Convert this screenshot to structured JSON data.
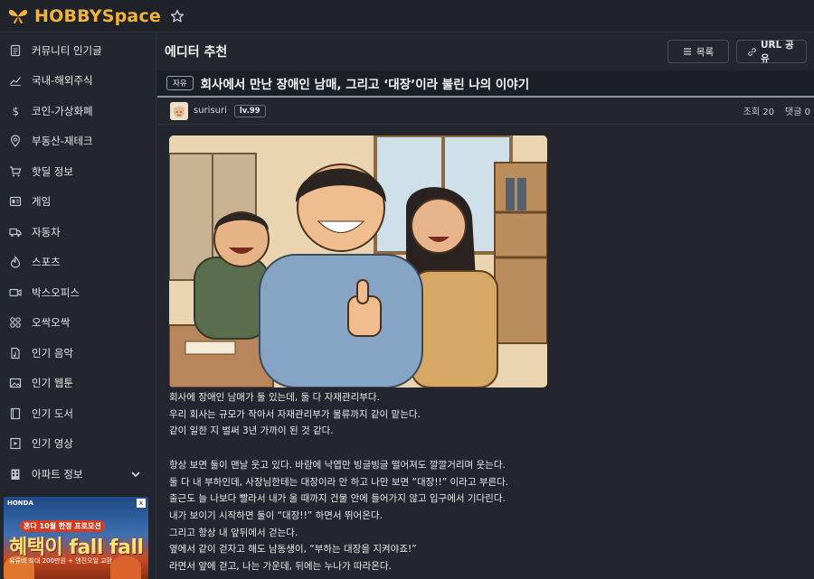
{
  "header": {
    "logo_text": "HOBBYSpace",
    "accent_color": "#f2b33d"
  },
  "sidebar": {
    "items": [
      {
        "label": "커뮤니티 인기글",
        "icon": "document-icon"
      },
      {
        "label": "국내-해외주식",
        "icon": "chart-line-icon"
      },
      {
        "label": "코인-가상화폐",
        "icon": "dollar-icon"
      },
      {
        "label": "부동산-재테크",
        "icon": "location-pin-icon"
      },
      {
        "label": "핫딜 정보",
        "icon": "cart-icon"
      },
      {
        "label": "게임",
        "icon": "gamepad-icon"
      },
      {
        "label": "자동차",
        "icon": "truck-icon"
      },
      {
        "label": "스포츠",
        "icon": "flame-icon"
      },
      {
        "label": "박스오피스",
        "icon": "video-camera-icon"
      },
      {
        "label": "오싹오싹",
        "icon": "grid-icon"
      },
      {
        "label": "인기 음악",
        "icon": "music-file-icon"
      },
      {
        "label": "인기 웹툰",
        "icon": "image-icon"
      },
      {
        "label": "인기 도서",
        "icon": "book-icon"
      },
      {
        "label": "인기 영상",
        "icon": "play-file-icon"
      },
      {
        "label": "아파트 정보",
        "icon": "building-icon"
      }
    ],
    "ad": {
      "brand": "HONDA",
      "close": "x",
      "sub": "혼다 10월 한정 프로모션",
      "title": "혜택이 fall fall",
      "foot": "유류비 최대 200만원 + 엔진오일 교환"
    }
  },
  "main": {
    "page_title": "에디터 추천",
    "list_button": "목록",
    "share_button": "URL 공유",
    "post": {
      "tag": "자유",
      "title": "회사에서 만난 장애인 남매, 그리고 ‘대장’이라 불린 나의 이야기",
      "username": "surisuri",
      "level": "lv.99",
      "views": "조회 20",
      "comments": "댓글 0",
      "body": [
        "회사에 장애인 남매가 둘 있는데, 둘 다 자재관리부다.",
        "우리 회사는 규모가 작아서 자재관리부가 물류까지 같이 맡는다.",
        "같이 일한 지 벌써 3년 가까이 된 것 같다.",
        "",
        "항상 보면 둘이 맨날 웃고 있다. 바람에 낙엽만 빙글빙글 떨어져도 깔깔거리며 웃는다.",
        "둘 다 내 부하인데, 사장님한테는 대장이라 안 하고 나만 보면 “대장!!” 이라고 부른다.",
        "출근도 늘 나보다 빨라서 내가 올 때까지 건물 안에 들어가지 않고 입구에서 기다린다.",
        "내가 보이기 시작하면 둘이 “대장!!” 하면서 뛰어온다.",
        "그리고 항상 내 앞뒤에서 걷는다.",
        "옆에서 같이 걷자고 해도 남동생이, “부하는 대장을 지켜야죠!”",
        "라면서 앞에 걷고, 나는 가운데, 뒤에는 누나가 따라온다."
      ]
    }
  }
}
